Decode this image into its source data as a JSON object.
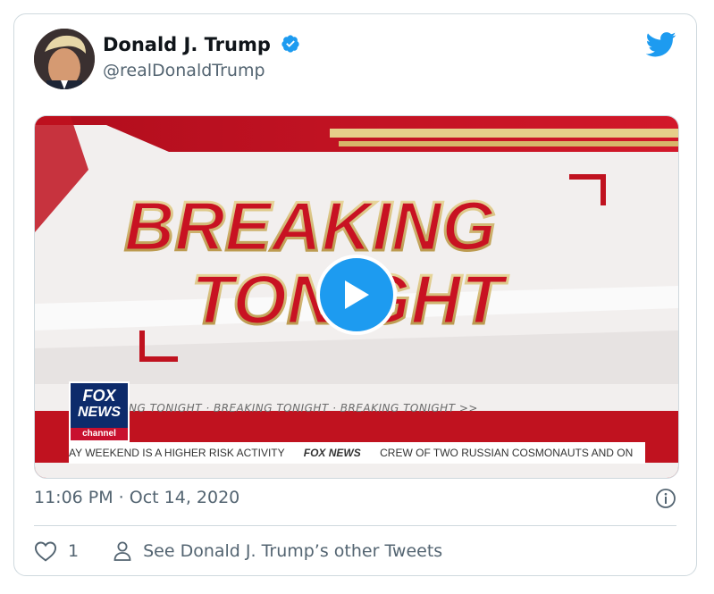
{
  "tweet": {
    "author_name": "Donald J. Trump",
    "author_handle": "@realDonaldTrump",
    "timestamp": "11:06 PM · Oct 14, 2020",
    "like_count": "1",
    "see_more_label": "See Donald J. Trump’s other Tweets"
  },
  "media": {
    "headline_line1": "BREAKING",
    "headline_line2": "TONIGHT",
    "ticker_top": "NG TONIGHT  ·  BREAKING TONIGHT  ·  BREAKING TONIGHT  >>",
    "ticker_bottom_left": "AY WEEKEND IS A HIGHER RISK ACTIVITY",
    "ticker_bottom_brand": "FOX NEWS",
    "ticker_bottom_right": "CREW OF TWO RUSSIAN COSMONAUTS AND ON",
    "logo_line1": "FOX",
    "logo_line2": "NEWS",
    "logo_line3": "channel"
  },
  "icons": {
    "verified": "verified-badge-icon",
    "twitter": "twitter-bird-icon",
    "play": "play-icon",
    "info": "info-icon",
    "like": "heart-icon",
    "person": "person-icon"
  },
  "colors": {
    "twitter_blue": "#1d9bf0",
    "text_primary": "#0f1419",
    "text_secondary": "#536471",
    "fox_red": "#c8102e"
  }
}
